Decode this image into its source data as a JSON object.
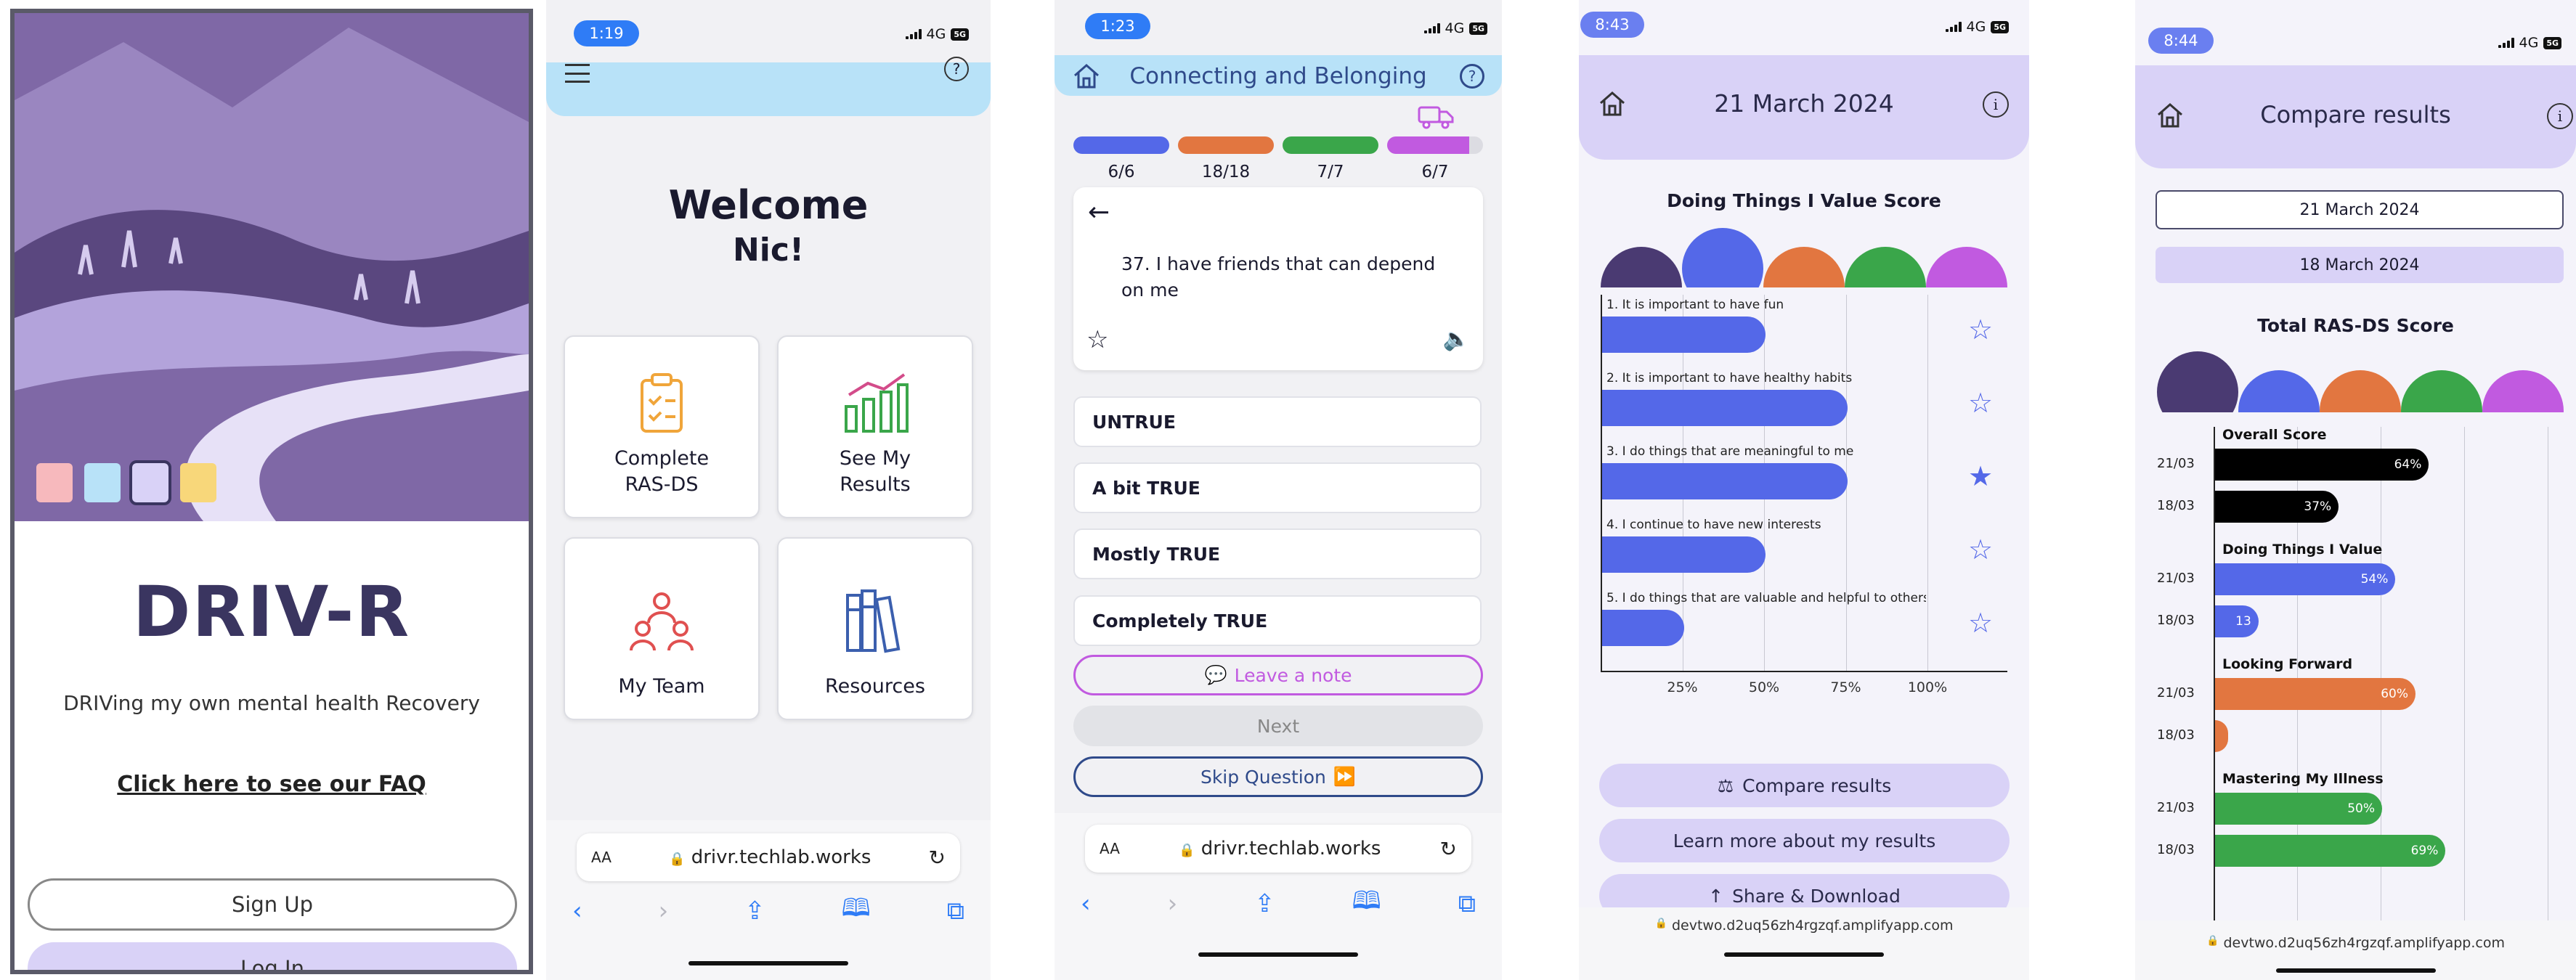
{
  "colors": {
    "lavender": "#d9d2f7",
    "sky": "#b8e2f8",
    "purple_dark": "#4a3a72",
    "blue": "#5468e8",
    "orange": "#e27640",
    "green": "#3aa64a",
    "magenta": "#c15ae0",
    "ios_blue": "#2f7cf6",
    "brand": "#3a3560"
  },
  "status": {
    "network": "4G",
    "battery": "5G"
  },
  "s1": {
    "logo": "DRIV-R",
    "tagline": "DRIVing my own mental health Recovery",
    "faq": "Click here to see our FAQ",
    "signup": "Sign Up",
    "login": "Log In",
    "swatches": [
      "#f7b9bd",
      "#b8e2f8",
      "#d9d2f7",
      "#f8d77a"
    ]
  },
  "s2": {
    "time": "1:19",
    "welcome": "Welcome",
    "name": "Nic!",
    "cards": [
      {
        "label1": "Complete",
        "label2": "RAS-DS",
        "icon": "clipboard-icon"
      },
      {
        "label1": "See My",
        "label2": "Results",
        "icon": "bar-chart-icon"
      },
      {
        "label1": "My Team",
        "label2": "",
        "icon": "team-icon"
      },
      {
        "label1": "Resources",
        "label2": "",
        "icon": "books-icon"
      }
    ],
    "url": "drivr.techlab.works",
    "aa": "AA"
  },
  "s3": {
    "time": "1:23",
    "title": "Connecting and Belonging",
    "progress": [
      {
        "label": "6/6",
        "color": "#5468e8"
      },
      {
        "label": "18/18",
        "color": "#e27640"
      },
      {
        "label": "7/7",
        "color": "#3aa64a"
      },
      {
        "label": "6/7",
        "color": "#c15ae0"
      }
    ],
    "question": "37. I have friends that can depend on me",
    "answers": [
      "UNTRUE",
      "A bit TRUE",
      "Mostly TRUE",
      "Completely TRUE"
    ],
    "note": "Leave a note",
    "next": "Next",
    "skip": "Skip Question",
    "url": "drivr.techlab.works",
    "aa": "AA"
  },
  "s4": {
    "time": "8:43",
    "date": "21 March 2024",
    "chart_data": {
      "type": "bar",
      "title": "Doing Things I Value Score",
      "categories": [
        "1. It is important to have fun",
        "2. It is important to have healthy habits",
        "3. I do things that are meaningful to me",
        "4. I continue to have new interests",
        "5. I do things that are valuable and helpful to others"
      ],
      "values": [
        50,
        75,
        75,
        50,
        25
      ],
      "starred": [
        false,
        false,
        true,
        false,
        false
      ],
      "xticks": [
        "25%",
        "50%",
        "75%",
        "100%"
      ],
      "xlim": [
        0,
        100
      ],
      "bar_color": "#5468e8"
    },
    "compare": "Compare results",
    "learn": "Learn more about my results",
    "share": "Share & Download",
    "url": "devtwo.d2uq56zh4rgzqf.amplifyapp.com"
  },
  "s5": {
    "time": "8:44",
    "title": "Compare results",
    "date1": "21 March 2024",
    "date2": "18 March 2024",
    "chart_data": {
      "type": "bar",
      "title": "Total RAS-DS Score",
      "groups": [
        {
          "name": "Overall Score",
          "color": "#000000",
          "rows": [
            {
              "date": "21/03",
              "value": 64,
              "label": "64%"
            },
            {
              "date": "18/03",
              "value": 37,
              "label": "37%"
            }
          ]
        },
        {
          "name": "Doing Things I Value",
          "color": "#5468e8",
          "rows": [
            {
              "date": "21/03",
              "value": 54,
              "label": "54%"
            },
            {
              "date": "18/03",
              "value": 13,
              "label": "13"
            }
          ]
        },
        {
          "name": "Looking Forward",
          "color": "#e27640",
          "rows": [
            {
              "date": "21/03",
              "value": 60,
              "label": "60%"
            },
            {
              "date": "18/03",
              "value": 3,
              "label": ""
            }
          ]
        },
        {
          "name": "Mastering My Illness",
          "color": "#3aa64a",
          "rows": [
            {
              "date": "21/03",
              "value": 50,
              "label": "50%"
            },
            {
              "date": "18/03",
              "value": 69,
              "label": "69%"
            }
          ]
        }
      ],
      "xlim": [
        0,
        100
      ]
    },
    "url": "devtwo.d2uq56zh4rgzqf.amplifyapp.com"
  }
}
